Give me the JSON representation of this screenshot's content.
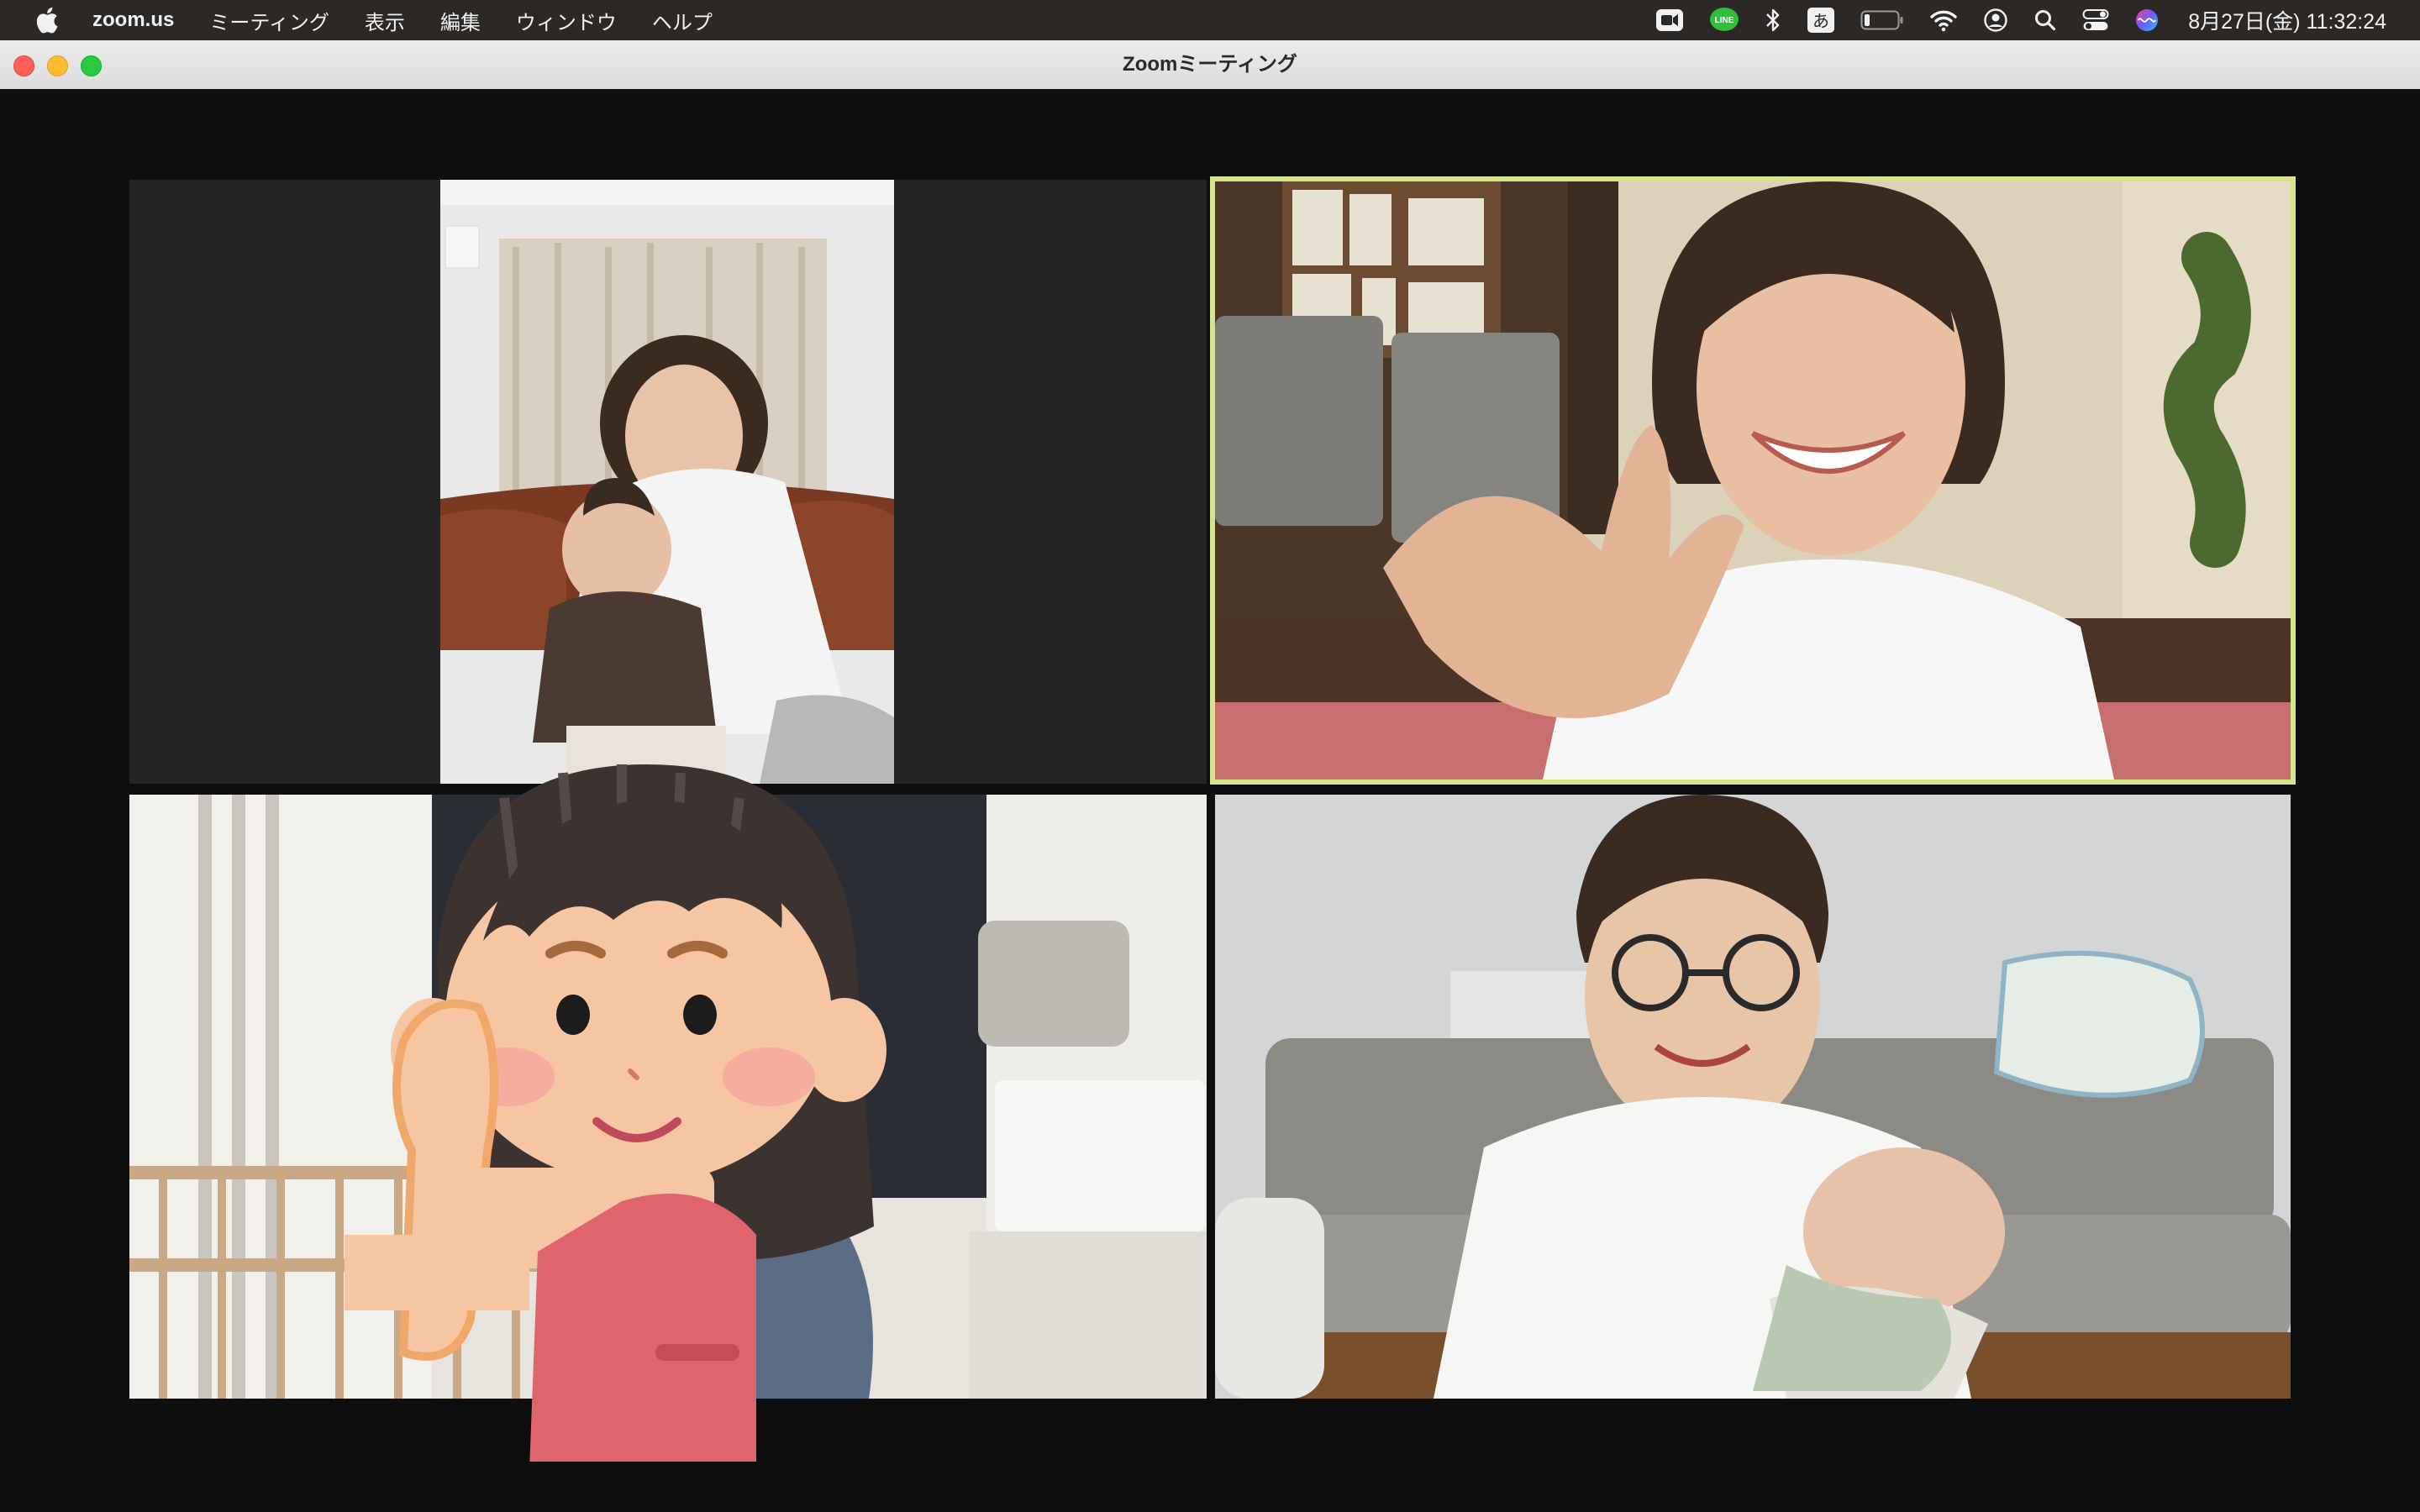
{
  "menubar": {
    "app_name": "zoom.us",
    "menus": [
      "ミーティング",
      "表示",
      "編集",
      "ウィンドウ",
      "ヘルプ"
    ],
    "status_icons": [
      "zoom-camera-icon",
      "line-icon",
      "bluetooth-icon",
      "input-method-icon",
      "battery-icon",
      "wifi-icon",
      "user-account-icon",
      "spotlight-search-icon",
      "control-center-icon",
      "siri-icon"
    ],
    "line_label": "LINE",
    "input_method_label": "あ",
    "clock": "8月27日(金)  11:32:24"
  },
  "window": {
    "title": "Zoomミーティング",
    "traffic_lights": {
      "close": "#fe5f57",
      "minimize": "#febc2e",
      "zoom": "#28c840"
    }
  },
  "meeting": {
    "layout": "gallery",
    "participants": [
      {
        "tile": 1,
        "description_icon": "video-feed"
      },
      {
        "tile": 2,
        "description_icon": "video-feed",
        "active_speaker": true
      },
      {
        "tile": 3,
        "description_icon": "video-feed"
      },
      {
        "tile": 4,
        "description_icon": "video-feed"
      }
    ],
    "active_speaker_border_color": "#d7e58a"
  }
}
